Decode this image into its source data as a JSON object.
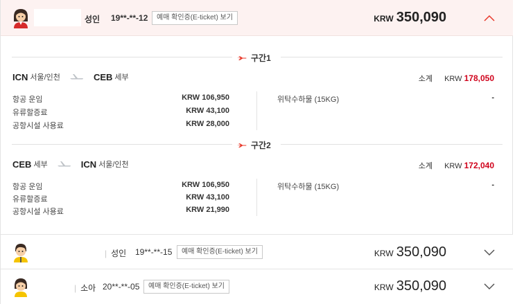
{
  "passengers": [
    {
      "type": "성인",
      "birth": "19**-**-12",
      "ticket_button": "예매 확인증(E-ticket) 보기",
      "currency": "KRW",
      "total": "350,090",
      "expanded": true
    },
    {
      "type": "성인",
      "birth": "19**-**-15",
      "ticket_button": "예매 확인증(E-ticket) 보기",
      "currency": "KRW",
      "total": "350,090",
      "expanded": false
    },
    {
      "type": "소아",
      "birth": "20**-**-05",
      "ticket_button": "예매 확인증(E-ticket) 보기",
      "currency": "KRW",
      "total": "350,090",
      "expanded": false
    }
  ],
  "segments": [
    {
      "label": "구간1",
      "origin_code": "ICN",
      "origin_city": "서울/인천",
      "dest_code": "CEB",
      "dest_city": "세부",
      "subtotal_label": "소계",
      "subtotal_currency": "KRW",
      "subtotal": "178,050",
      "fees": [
        {
          "label": "항공 운임",
          "value": "KRW 106,950"
        },
        {
          "label": "유류할증료",
          "value": "KRW 43,100"
        },
        {
          "label": "공항시설 사용료",
          "value": "KRW 28,000"
        }
      ],
      "baggage_label": "위탁수하물 (15KG)",
      "baggage_value": "-"
    },
    {
      "label": "구간2",
      "origin_code": "CEB",
      "origin_city": "세부",
      "dest_code": "ICN",
      "dest_city": "서울/인천",
      "subtotal_label": "소계",
      "subtotal_currency": "KRW",
      "subtotal": "172,040",
      "fees": [
        {
          "label": "항공 운임",
          "value": "KRW 106,950"
        },
        {
          "label": "유류할증료",
          "value": "KRW 43,100"
        },
        {
          "label": "공항시설 사용료",
          "value": "KRW 21,990"
        }
      ],
      "baggage_label": "위탁수하물 (15KG)",
      "baggage_value": "-"
    }
  ],
  "icons": {
    "expanded_chevron": "chevron-up-icon",
    "collapsed_chevron": "chevron-down-icon",
    "segment_icon": "airplane-icon",
    "route_icon": "airplane-icon"
  },
  "colors": {
    "accent": "#e8382a",
    "subtotal": "#d0021b",
    "expanded_bg": "#fdf2f1"
  }
}
